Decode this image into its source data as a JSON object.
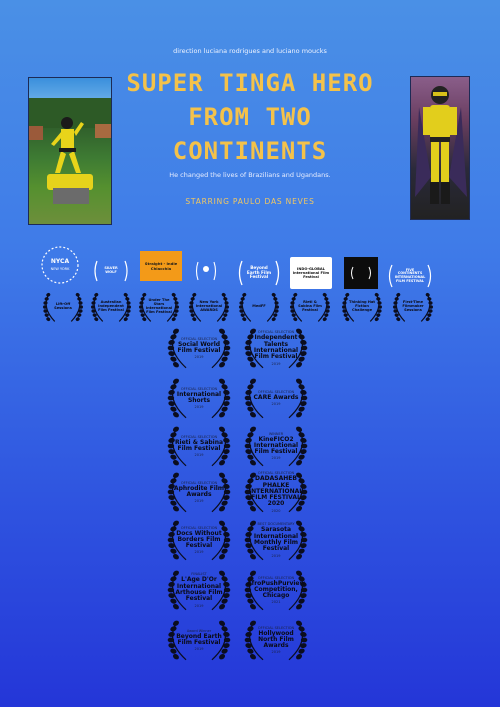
{
  "poster": {
    "credit": "direction luciana rodrigues and luciano moucks",
    "title_lines": [
      "SUPER TINGA HERO",
      "FROM TWO",
      "CONTINENTS"
    ],
    "tagline": "He changed the lives of Brazilians and Ugandans.",
    "starring": "STARRING PAULO DAS NEVES"
  },
  "colors": {
    "title": "#f4c24a",
    "background_top": "#4a90e6",
    "background_bottom": "#2436d8"
  },
  "laurels_row1": [
    {
      "name": "NYCA",
      "sub": "NEW YORK"
    },
    {
      "name": "SILVER WOLF",
      "sub": ""
    },
    {
      "name": "Straight - Indie Chiacchia",
      "sub": ""
    },
    {
      "name": "",
      "sub": ""
    },
    {
      "name": "Beyond Earth Film Festival",
      "sub": ""
    },
    {
      "name": "INDO-GLOBAL International Film Festival",
      "sub": ""
    },
    {
      "name": "",
      "sub": ""
    },
    {
      "name": "FIVE CONTINENTS INTERNATIONAL FILM FESTIVAL",
      "sub": ""
    }
  ],
  "laurels_row2": [
    {
      "name": "Lift-Off Sessions",
      "sub": ""
    },
    {
      "name": "Australian Independent Film Festival",
      "sub": ""
    },
    {
      "name": "Under The Stars International Film Festival",
      "sub": ""
    },
    {
      "name": "New York International AWARDS",
      "sub": ""
    },
    {
      "name": "MedFF",
      "sub": ""
    },
    {
      "name": "Rieti & Sabina Film Festival",
      "sub": ""
    },
    {
      "name": "Thinking Hat Fiction Challenge",
      "sub": ""
    },
    {
      "name": "First-Time Filmmaker Sessions",
      "sub": ""
    }
  ],
  "laurels_column": [
    {
      "label": "OFFICIAL SELECTION",
      "name": "Social World Film Festival",
      "year": "2019"
    },
    {
      "label": "OFFICIAL SELECTION",
      "name": "Independent Talents International Film Festival",
      "year": "2019"
    },
    {
      "label": "OFFICIAL SELECTION",
      "name": "International Shorts",
      "year": "2019"
    },
    {
      "label": "OFFICIAL SELECTION",
      "name": "CARE Awards",
      "year": "2019"
    },
    {
      "label": "OFFICIAL SELECTION",
      "name": "Rieti & Sabina Film Festival",
      "year": "2019"
    },
    {
      "label": "WINNER",
      "name": "KineFICO2 International Film Festival",
      "year": "2019"
    },
    {
      "label": "OFFICIAL SELECTION",
      "name": "Aphrodite Film Awards",
      "year": "2019"
    },
    {
      "label": "OFFICIAL SELECTION",
      "name": "DADASAHEB PHALKE INTERNATIONAL FILM FESTIVAL 2020",
      "year": "2020"
    },
    {
      "label": "OFFICIAL SELECTION",
      "name": "Docs Without Borders Film Festival",
      "year": "2019"
    },
    {
      "label": "BEST DOCUMENTARY",
      "name": "Sarasota International Monthly Film Festival",
      "year": "2019"
    },
    {
      "label": "FINALIST",
      "name": "L'Age D'Or International Arthouse Film Festival",
      "year": "2019"
    },
    {
      "label": "OFFICIAL SELECTION",
      "name": "AfroPushPurview Competition, Chicago",
      "year": "2021"
    },
    {
      "label": "Award Winner",
      "name": "Beyond Earth Film Festival",
      "year": "2019"
    },
    {
      "label": "OFFICIAL SELECTION",
      "name": "Hollywood North Film Awards",
      "year": "2019"
    }
  ]
}
